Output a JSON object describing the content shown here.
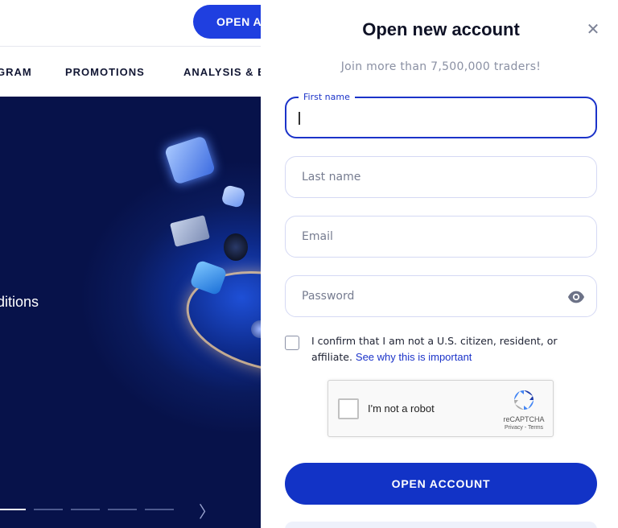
{
  "site": {
    "header_button": "OPEN A",
    "nav": [
      {
        "label": "GRAM"
      },
      {
        "label": "PROMOTIONS"
      },
      {
        "label": "ANALYSIS & E"
      }
    ],
    "hero_text": "ditions",
    "slider_next": "〉"
  },
  "modal": {
    "title": "Open new account",
    "close_glyph": "✕",
    "subtitle": "Join more than 7,500,000 traders!",
    "fields": {
      "first_name": {
        "label": "First name",
        "value": ""
      },
      "last_name": {
        "placeholder": "Last name",
        "value": ""
      },
      "email": {
        "placeholder": "Email",
        "value": ""
      },
      "password": {
        "placeholder": "Password",
        "value": ""
      }
    },
    "confirm": {
      "text": "I confirm that I am not a U.S. citizen, resident, or affiliate.",
      "link": "See why this is important",
      "checked": false
    },
    "captcha": {
      "label": "I'm not a robot",
      "brand": "reCAPTCHA",
      "terms": "Privacy - Terms"
    },
    "submit_label": "OPEN ACCOUNT"
  },
  "colors": {
    "primary": "#1233c6",
    "focus_border": "#1b33c9",
    "hero_bg": "#0a1a5c"
  },
  "icons": [
    "close-icon",
    "eye-icon",
    "recaptcha-logo-icon",
    "chevron-right-icon"
  ]
}
